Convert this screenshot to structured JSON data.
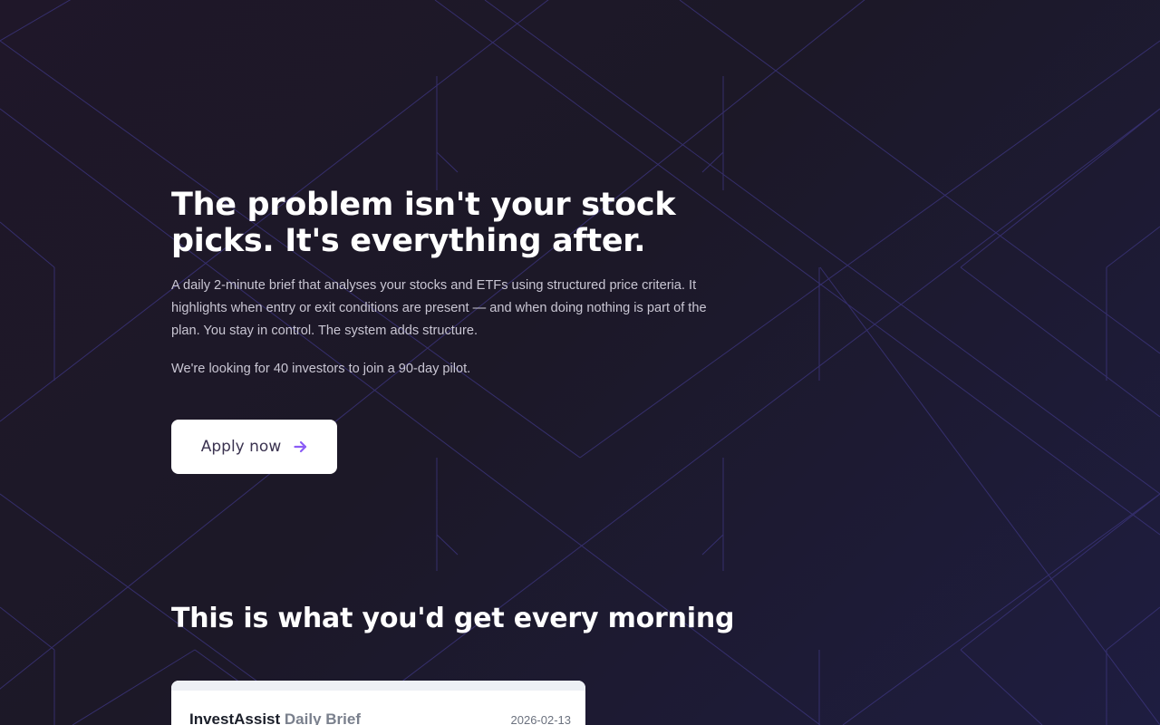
{
  "hero": {
    "title": "The problem isn't your stock picks. It's everything after.",
    "lead": "A daily 2-minute brief that analyses your stocks and ETFs using structured price criteria. It highlights when entry or exit conditions are present — and when doing nothing is part of the plan. You stay in control. The system adds structure.",
    "pilot": "We're looking for 40 investors to join a 90-day pilot.",
    "cta_label": "Apply now",
    "cta_icon": "arrow-right-icon"
  },
  "preview": {
    "title": "This is what you'd get every morning",
    "brief": {
      "brand": "InvestAssist",
      "subtitle": "Daily Brief",
      "date": "2026-02-13"
    }
  },
  "colors": {
    "background": "#1c1827",
    "accent": "#8b5cf6",
    "pattern_line": "#3a3378"
  }
}
